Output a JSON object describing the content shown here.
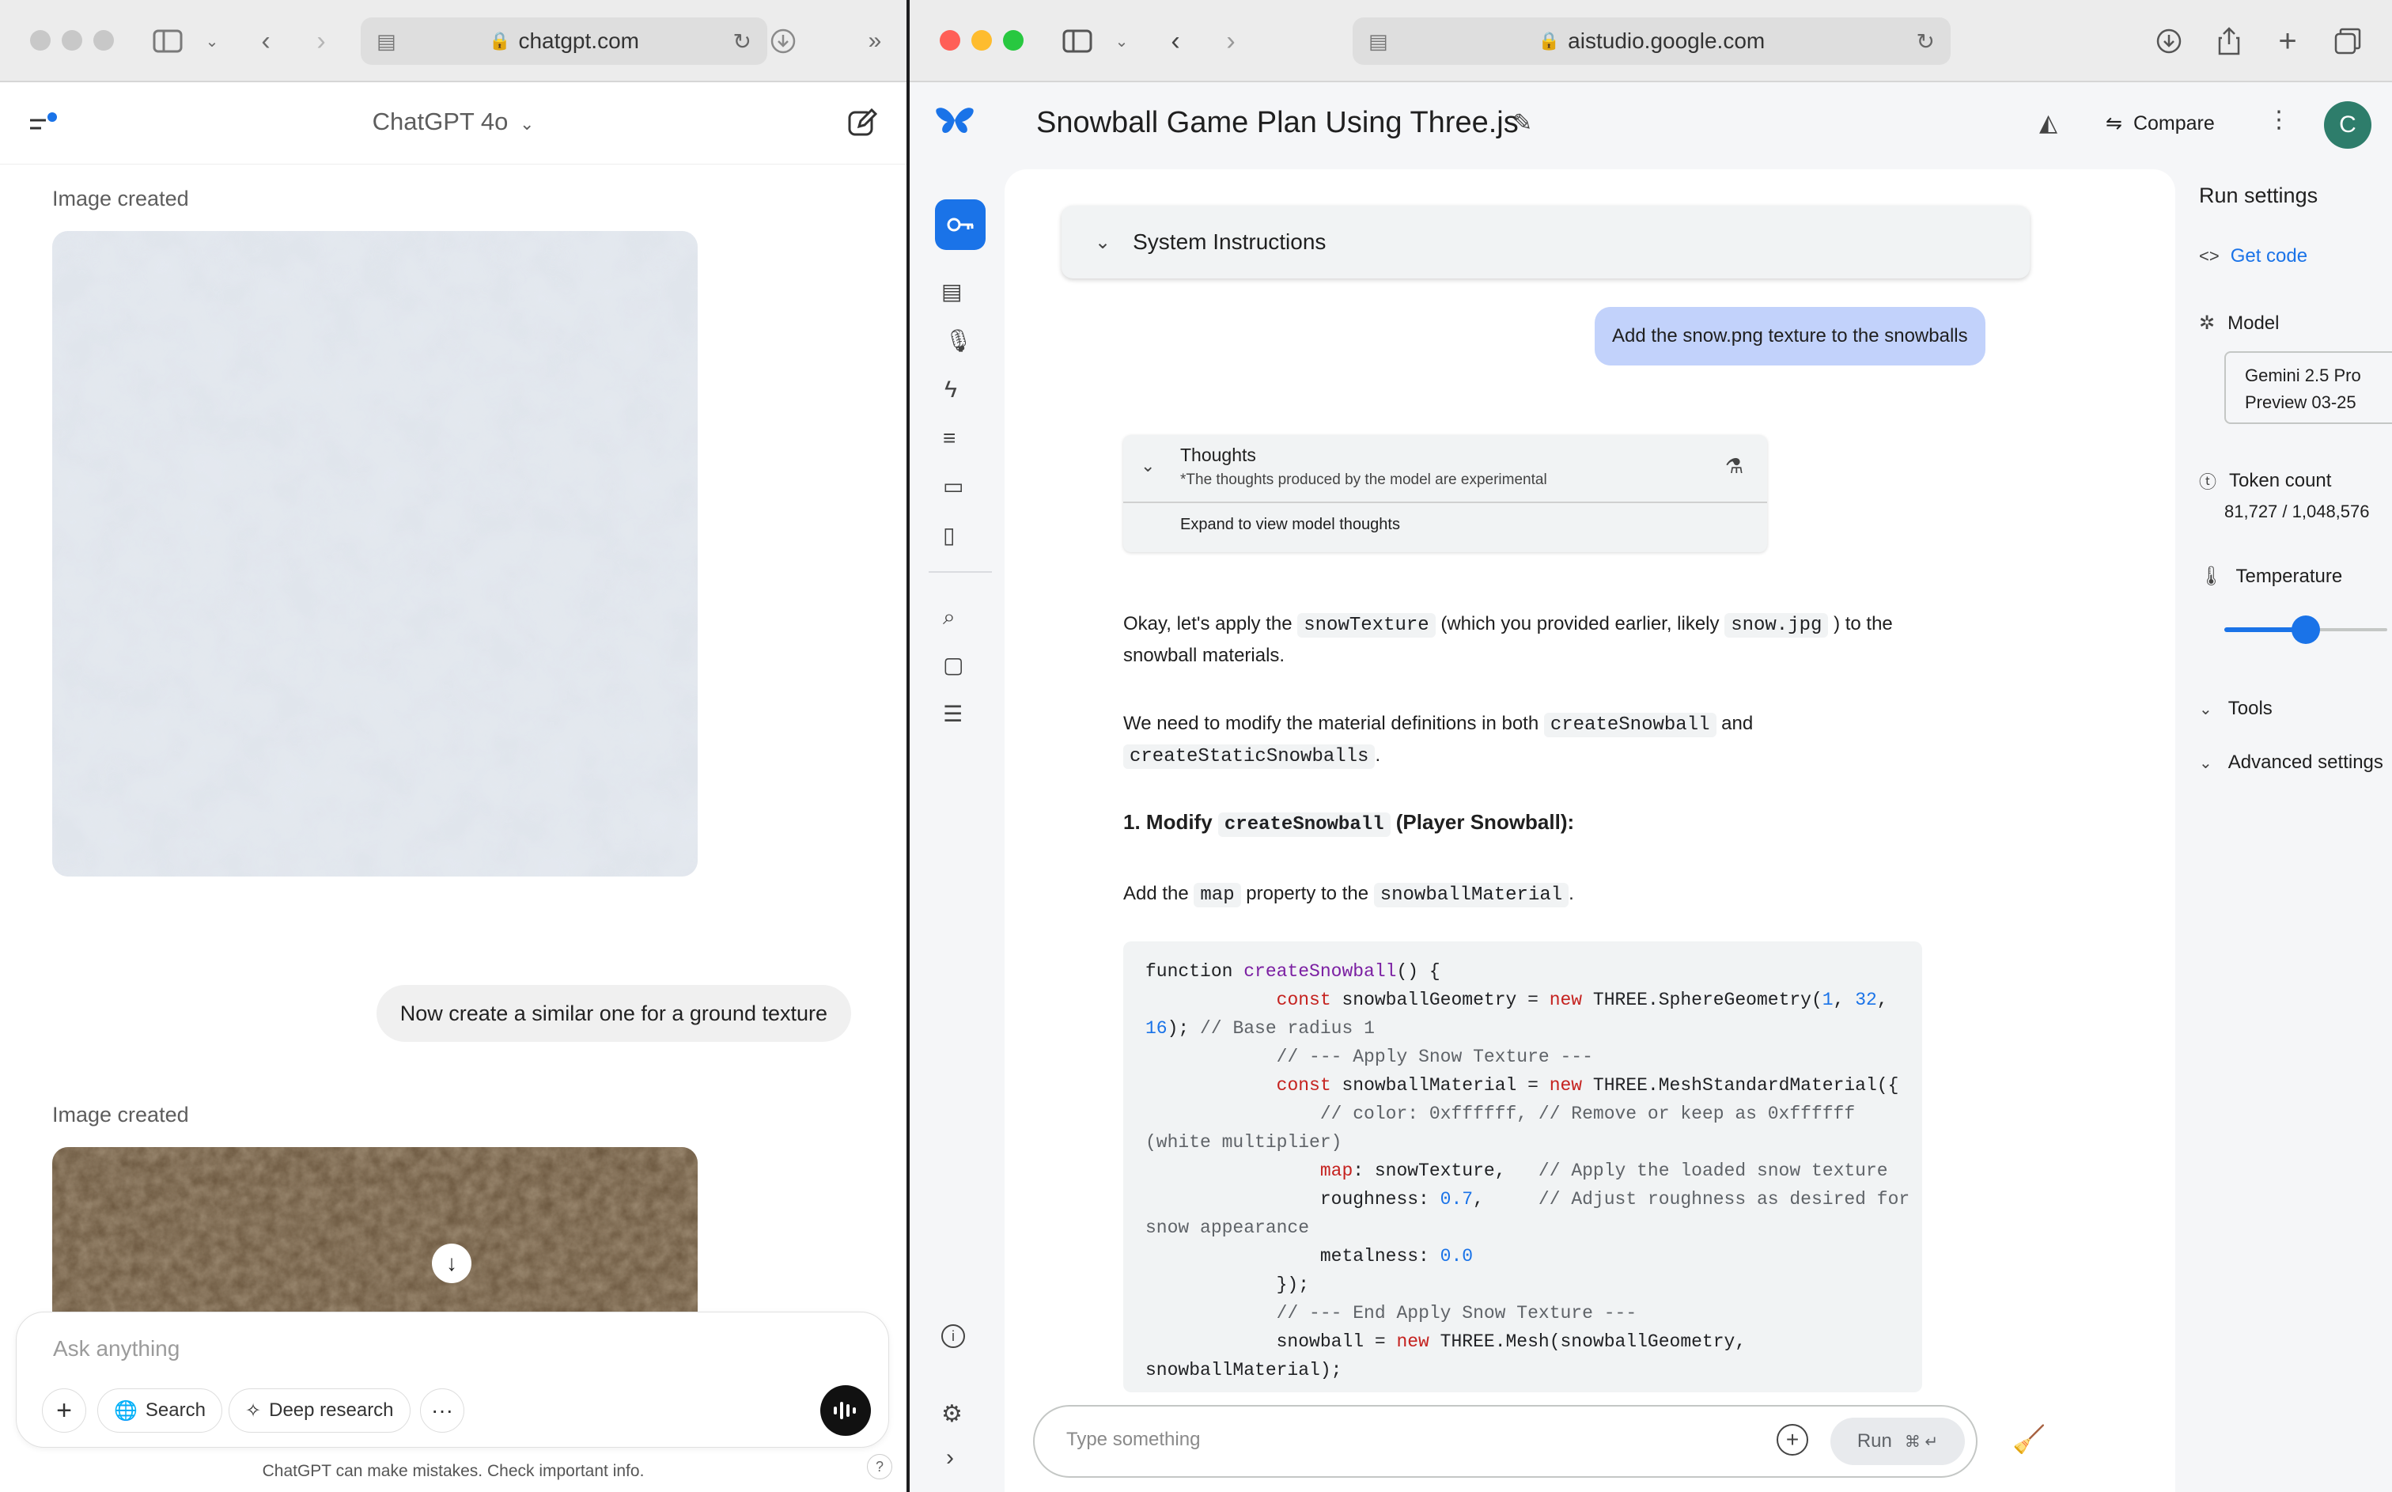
{
  "left_window": {
    "url": "chatgpt.com",
    "model_title": "ChatGPT 4o",
    "image_created_label_1": "Image created",
    "image_created_label_2": "Image created",
    "user_message": "Now create a similar one for a ground texture",
    "composer_placeholder": "Ask anything",
    "search_label": "Search",
    "deep_research_label": "Deep research",
    "disclaimer": "ChatGPT can make mistakes. Check important info.",
    "help_label": "?"
  },
  "right_window": {
    "url": "aistudio.google.com",
    "page_title": "Snowball Game Plan Using Three.js",
    "compare_label": "Compare",
    "avatar_letter": "C",
    "system_instructions_label": "System Instructions",
    "user_message": "Add the snow.png texture to the snowballs",
    "thoughts": {
      "title": "Thoughts",
      "subtitle": "*The thoughts produced by the model are experimental",
      "expand_label": "Expand to view model thoughts"
    },
    "response": {
      "p1_a": "Okay, let's apply the ",
      "p1_code1": "snowTexture",
      "p1_b": " (which you provided earlier, likely ",
      "p1_code2": "snow.jpg",
      "p1_c": " ) to the",
      "p1_d": "snowball materials.",
      "p2_a": "We need to modify the material definitions in both ",
      "p2_code1": "createSnowball",
      "p2_b": " and",
      "p2_code2": "createStaticSnowballs",
      "p2_c": ".",
      "h_a": "1. Modify ",
      "h_code": "createSnowball",
      "h_b": " (Player Snowball):",
      "p3_a": "Add the ",
      "p3_code1": "map",
      "p3_b": " property to the ",
      "p3_code2": "snowballMaterial",
      "p3_c": "."
    },
    "code_lines": [
      "function createSnowball() {",
      "            const snowballGeometry = new THREE.SphereGeometry(1, 32,",
      "16); // Base radius 1",
      "            // --- Apply Snow Texture ---",
      "            const snowballMaterial = new THREE.MeshStandardMaterial({",
      "                // color: 0xffffff, // Remove or keep as 0xffffff",
      "(white multiplier)",
      "                map: snowTexture,   // Apply the loaded snow texture",
      "                roughness: 0.7,     // Adjust roughness as desired for",
      "snow appearance",
      "                metalness: 0.0",
      "            });",
      "            // --- End Apply Snow Texture ---",
      "            snowball = new THREE.Mesh(snowballGeometry,",
      "snowballMaterial);"
    ],
    "input_placeholder": "Type something",
    "run_label": "Run",
    "run_shortcut": "⌘ ↵",
    "run_settings": {
      "title": "Run settings",
      "get_code": "Get code",
      "model_label": "Model",
      "model_value_1": "Gemini 2.5 Pro",
      "model_value_2": "Preview 03-25",
      "token_count_label": "Token count",
      "token_count_value": "81,727 / 1,048,576",
      "temperature_label": "Temperature",
      "temperature_value": "1",
      "temperature_fraction": 0.5,
      "tools_label": "Tools",
      "advanced_label": "Advanced settings"
    }
  },
  "colors": {
    "accent_blue": "#1a73e8",
    "user_bubble": "#c2d2fb",
    "avatar": "#2e7d6b"
  }
}
